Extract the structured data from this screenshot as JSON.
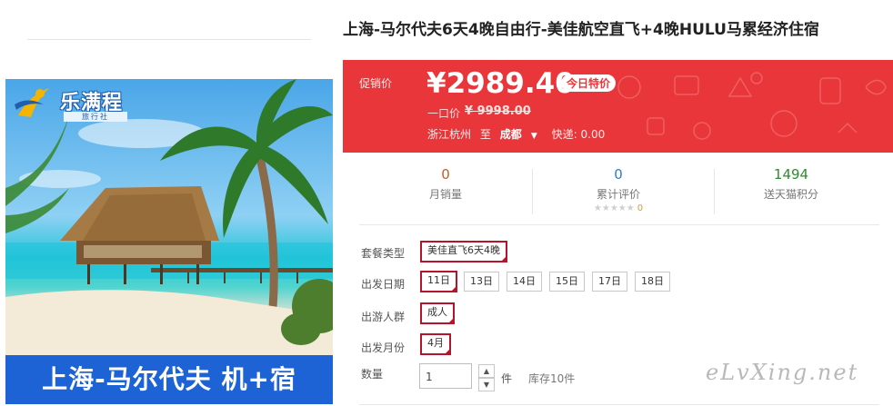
{
  "gallery": {
    "logo_name": "乐满程",
    "logo_sub": "旅行社",
    "banner_text": "上海-马尔代夫 机+宿"
  },
  "product": {
    "title": "上海-马尔代夫6天4晚自由行-美佳航空直飞+4晚HULU马累经济住宿"
  },
  "price_box": {
    "promo_label": "促销价",
    "price": "¥2989.40",
    "badge": "今日特价",
    "original_label": "一口价",
    "original_price": "¥ 9998.00",
    "origin_city": "浙江杭州",
    "to": "至",
    "destination": "成都",
    "shipping_label": "快递: 0.00",
    "accent_color": "#e8363a"
  },
  "stats": {
    "monthly_sales_value": "0",
    "monthly_sales_label": "月销量",
    "reviews_value": "0",
    "reviews_label": "累计评价",
    "reviews_stars": "★★★★★",
    "reviews_score": "0",
    "points_value": "1494",
    "points_label": "送天猫积分"
  },
  "options": {
    "package_label": "套餐类型",
    "package_values": [
      "美佳直飞6天4晚"
    ],
    "date_label": "出发日期",
    "date_values": [
      "11日",
      "13日",
      "14日",
      "15日",
      "17日",
      "18日"
    ],
    "group_label": "出游人群",
    "group_values": [
      "成人"
    ],
    "month_label": "出发月份",
    "month_values": [
      "4月"
    ],
    "selected_color": "#b4142c"
  },
  "quantity": {
    "label": "数量",
    "value": "1",
    "unit": "件",
    "stock": "库存10件",
    "up_icon": "chevron-up-icon",
    "down_icon": "chevron-down-icon"
  },
  "watermark": "eLvXing.net"
}
